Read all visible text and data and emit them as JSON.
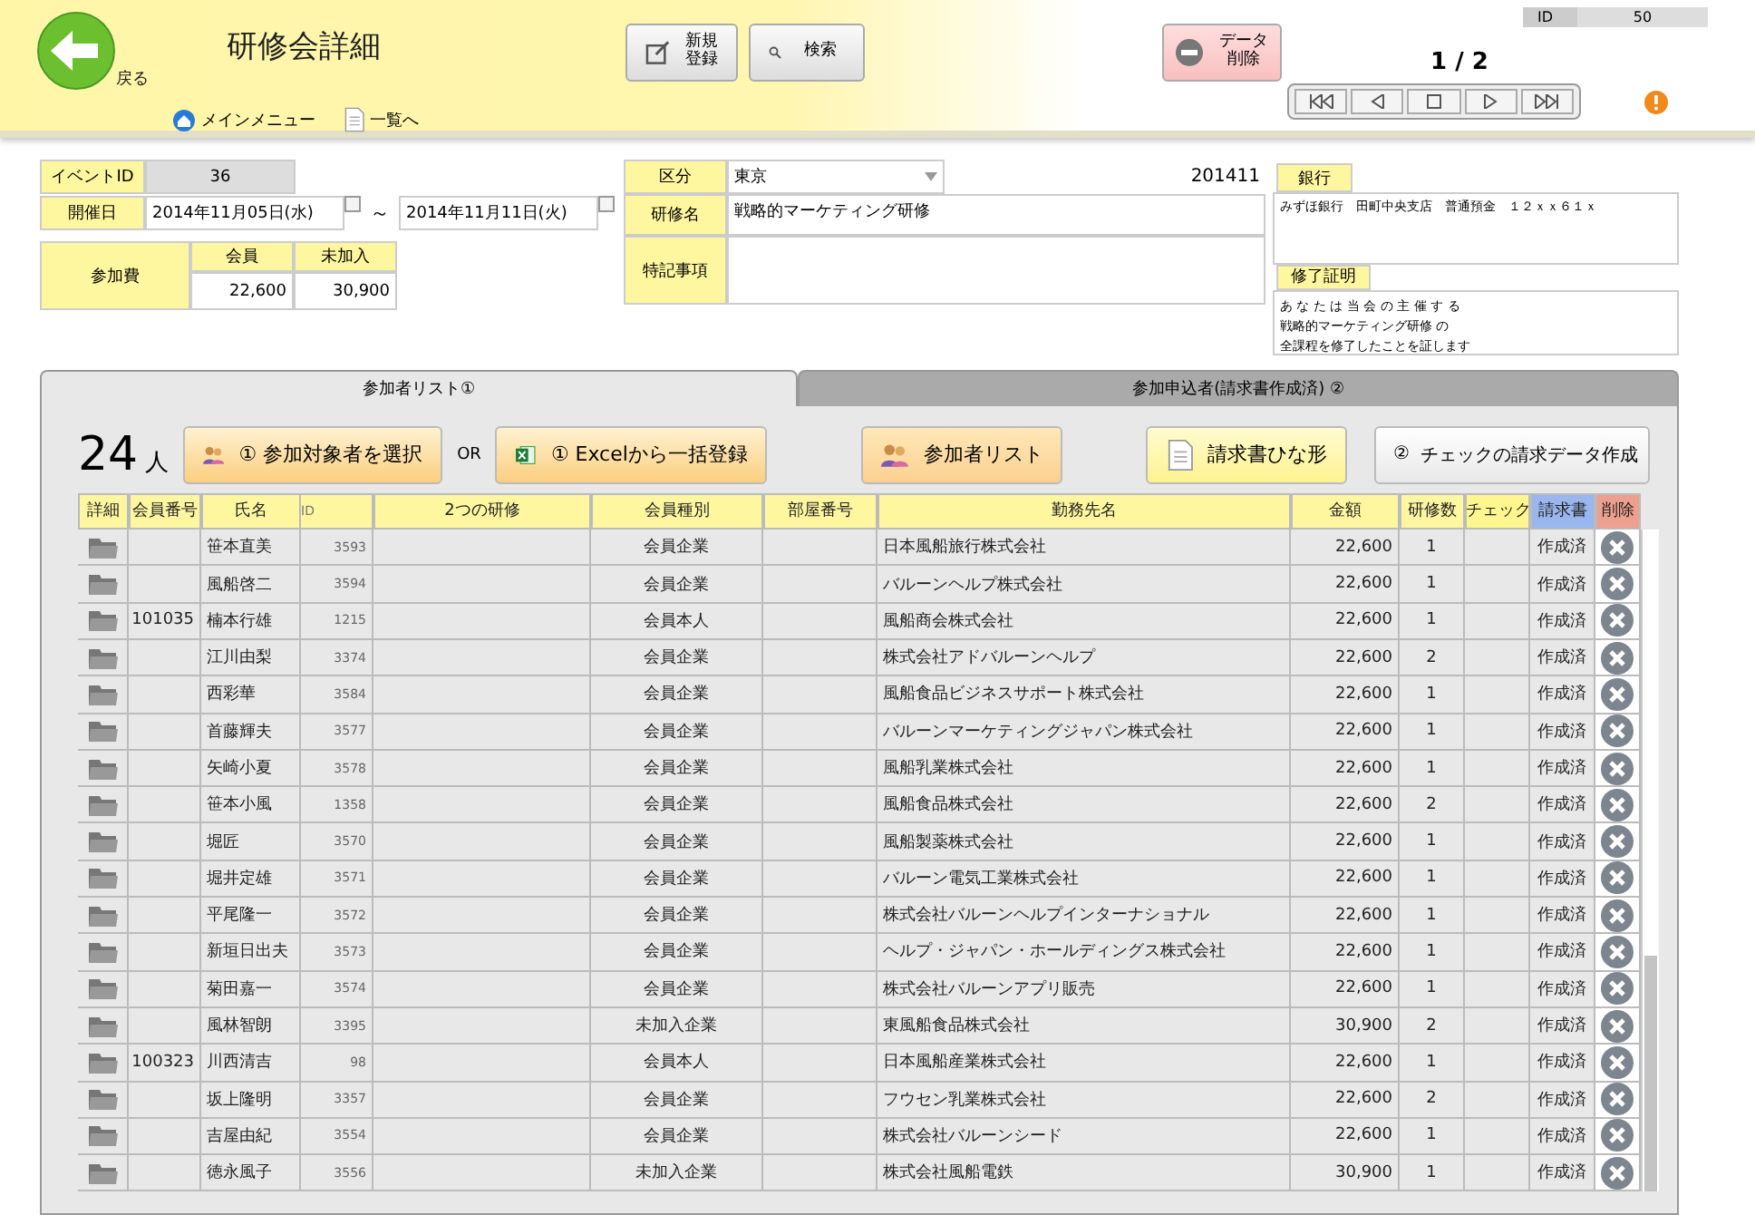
{
  "header": {
    "back_label": "戻る",
    "title": "研修会詳細",
    "links": [
      {
        "label": "メインメニュー",
        "kind": "home"
      },
      {
        "label": "一覧へ",
        "kind": "list"
      }
    ],
    "buttons": [
      {
        "label": "新規登録",
        "kind": "new"
      },
      {
        "label": "検索",
        "kind": "search"
      }
    ],
    "delete_button": "データ削除",
    "record": "1 / 2",
    "id_label": "ID",
    "id_value": "50"
  },
  "form": {
    "event_id": {
      "label": "イベントID",
      "value": "36"
    },
    "dates": {
      "label": "開催日",
      "start": "2014年11月05日(水)",
      "separator": "～",
      "end": "2014年11月11日(火)"
    },
    "fee": {
      "label": "参加費",
      "columns": [
        "会員",
        "未加入"
      ],
      "values": [
        "22,600",
        "30,900"
      ]
    },
    "category": {
      "label": "区分",
      "value": "東京"
    },
    "code": "201411",
    "course": {
      "label": "研修名",
      "value": "戦略的マーケティング研修"
    },
    "notes": {
      "label": "特記事項"
    },
    "bank": {
      "label": "銀行",
      "value": "みずほ銀行　田町中央支店　普通預金　１２ｘｘ６１ｘ"
    },
    "certificate": {
      "label": "修了証明",
      "lines": [
        "あ な た は 当 会 の 主 催 す る",
        "戦略的マーケティング研修 の",
        "全課程を修了したことを証します"
      ]
    }
  },
  "tabs": [
    {
      "label": "参加者リスト①",
      "selected": true
    },
    {
      "label": "参加申込者(請求書作成済) ②",
      "selected": false
    }
  ],
  "toolbar": {
    "count": "24",
    "unit": "人",
    "or": "OR",
    "buttons": [
      {
        "kind": "people",
        "label": "① 参加対象者を選択"
      },
      {
        "kind": "excel",
        "label": "① Excelから一括登録"
      },
      {
        "kind": "people-list",
        "label": "参加者リスト"
      },
      {
        "kind": "template",
        "label": "請求書ひな形"
      },
      {
        "kind": "check",
        "prefix": "②",
        "label": "チェックの請求データ作成"
      }
    ]
  },
  "table": {
    "columns": [
      {
        "label": "詳細",
        "kind": "plain"
      },
      {
        "label": "会員番号",
        "kind": "plain"
      },
      {
        "label": "氏名",
        "kind": "plain"
      },
      {
        "label": "ID",
        "kind": "sub"
      },
      {
        "label": "2つの研修",
        "kind": "plain"
      },
      {
        "label": "会員種別",
        "kind": "plain"
      },
      {
        "label": "部屋番号",
        "kind": "plain"
      },
      {
        "label": "勤務先名",
        "kind": "plain"
      },
      {
        "label": "金額",
        "kind": "plain"
      },
      {
        "label": "研修数",
        "kind": "plain"
      },
      {
        "label": "チェック",
        "kind": "check"
      },
      {
        "label": "請求書",
        "kind": "invoice"
      },
      {
        "label": "削除",
        "kind": "delete"
      }
    ],
    "rows": [
      {
        "member_no": "",
        "name": "笹本直美",
        "id": "3593",
        "type": "会員企業",
        "company": "日本風船旅行株式会社",
        "amount": "22,600",
        "courses": "1",
        "invoice": "作成済"
      },
      {
        "member_no": "",
        "name": "風船啓二",
        "id": "3594",
        "type": "会員企業",
        "company": "バルーンヘルプ株式会社",
        "amount": "22,600",
        "courses": "1",
        "invoice": "作成済"
      },
      {
        "member_no": "101035",
        "name": "楠本行雄",
        "id": "1215",
        "type": "会員本人",
        "company": "風船商会株式会社",
        "amount": "22,600",
        "courses": "1",
        "invoice": "作成済"
      },
      {
        "member_no": "",
        "name": "江川由梨",
        "id": "3374",
        "type": "会員企業",
        "company": "株式会社アドバルーンヘルプ",
        "amount": "22,600",
        "courses": "2",
        "invoice": "作成済"
      },
      {
        "member_no": "",
        "name": "西彩華",
        "id": "3584",
        "type": "会員企業",
        "company": "風船食品ビジネスサポート株式会社",
        "amount": "22,600",
        "courses": "1",
        "invoice": "作成済"
      },
      {
        "member_no": "",
        "name": "首藤輝夫",
        "id": "3577",
        "type": "会員企業",
        "company": "バルーンマーケティングジャパン株式会社",
        "amount": "22,600",
        "courses": "1",
        "invoice": "作成済"
      },
      {
        "member_no": "",
        "name": "矢崎小夏",
        "id": "3578",
        "type": "会員企業",
        "company": "風船乳業株式会社",
        "amount": "22,600",
        "courses": "1",
        "invoice": "作成済"
      },
      {
        "member_no": "",
        "name": "笹本小風",
        "id": "1358",
        "type": "会員企業",
        "company": "風船食品株式会社",
        "amount": "22,600",
        "courses": "2",
        "invoice": "作成済"
      },
      {
        "member_no": "",
        "name": "堀匠",
        "id": "3570",
        "type": "会員企業",
        "company": "風船製薬株式会社",
        "amount": "22,600",
        "courses": "1",
        "invoice": "作成済"
      },
      {
        "member_no": "",
        "name": "堀井定雄",
        "id": "3571",
        "type": "会員企業",
        "company": "バルーン電気工業株式会社",
        "amount": "22,600",
        "courses": "1",
        "invoice": "作成済"
      },
      {
        "member_no": "",
        "name": "平尾隆一",
        "id": "3572",
        "type": "会員企業",
        "company": "株式会社バルーンヘルプインターナショナル",
        "amount": "22,600",
        "courses": "1",
        "invoice": "作成済"
      },
      {
        "member_no": "",
        "name": "新垣日出夫",
        "id": "3573",
        "type": "会員企業",
        "company": "ヘルプ・ジャパン・ホールディングス株式会社",
        "amount": "22,600",
        "courses": "1",
        "invoice": "作成済"
      },
      {
        "member_no": "",
        "name": "菊田嘉一",
        "id": "3574",
        "type": "会員企業",
        "company": "株式会社バルーンアプリ販売",
        "amount": "22,600",
        "courses": "1",
        "invoice": "作成済"
      },
      {
        "member_no": "",
        "name": "風林智朗",
        "id": "3395",
        "type": "未加入企業",
        "company": "東風船食品株式会社",
        "amount": "30,900",
        "courses": "2",
        "invoice": "作成済"
      },
      {
        "member_no": "100323",
        "name": "川西清吉",
        "id": "98",
        "type": "会員本人",
        "company": "日本風船産業株式会社",
        "amount": "22,600",
        "courses": "1",
        "invoice": "作成済"
      },
      {
        "member_no": "",
        "name": "坂上隆明",
        "id": "3357",
        "type": "会員企業",
        "company": "フウセン乳業株式会社",
        "amount": "22,600",
        "courses": "2",
        "invoice": "作成済"
      },
      {
        "member_no": "",
        "name": "吉屋由紀",
        "id": "3554",
        "type": "会員企業",
        "company": "株式会社バルーンシード",
        "amount": "22,600",
        "courses": "1",
        "invoice": "作成済"
      },
      {
        "member_no": "",
        "name": "徳永風子",
        "id": "3556",
        "type": "未加入企業",
        "company": "株式会社風船電鉄",
        "amount": "30,900",
        "courses": "1",
        "invoice": "作成済"
      }
    ]
  }
}
